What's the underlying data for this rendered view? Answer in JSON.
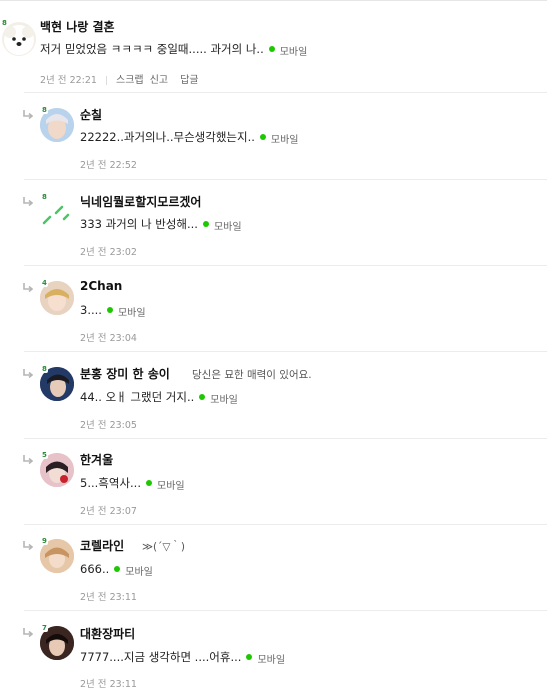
{
  "comments": [
    {
      "level": "8",
      "nickname": "백현 나랑 결혼",
      "text": "저거 믿었었음 ㅋㅋㅋㅋ 중일때..... 과거의 나..",
      "mobile": "모바일",
      "date": "2년 전",
      "time": "22:21",
      "actions": [
        "스크랩",
        "신고",
        "답글"
      ],
      "avatar_bg": "#f3efe6"
    },
    {
      "level": "8",
      "nickname": "순칠",
      "text": "22222..과거의나..무슨생각했는지..",
      "mobile": "모바일",
      "date": "2년 전",
      "time": "22:52",
      "avatar_bg": "#b9d3ec"
    },
    {
      "level": "8",
      "nickname": "닉네임뭘로할지모르겠어",
      "text": "333 과거의 나 반성해...",
      "mobile": "모바일",
      "date": "2년 전",
      "time": "23:02",
      "avatar_bg": "#ffffff"
    },
    {
      "level": "4",
      "nickname": "2Chan",
      "text": "3....",
      "mobile": "모바일",
      "date": "2년 전",
      "time": "23:04",
      "avatar_bg": "#e8d2c0"
    },
    {
      "level": "8",
      "nickname": "분홍 장미 한 송이",
      "extra": "당신은 묘한 매력이 있어요.",
      "text": "44.. 오ㅐ 그랬던 거지..",
      "mobile": "모바일",
      "date": "2년 전",
      "time": "23:05",
      "avatar_bg": "#243a66"
    },
    {
      "level": "5",
      "nickname": "한겨울",
      "text": "5...흑역사...",
      "mobile": "모바일",
      "date": "2년 전",
      "time": "23:07",
      "avatar_bg": "#e7c2c8"
    },
    {
      "level": "9",
      "nickname": "코렐라인",
      "extra": "≫(´▽｀)",
      "text": "666..",
      "mobile": "모바일",
      "date": "2년 전",
      "time": "23:11",
      "avatar_bg": "#dcb59a"
    },
    {
      "level": "7",
      "nickname": "대환장파티",
      "text": "7777....지금 생각하면 ....어휴...",
      "mobile": "모바일",
      "date": "2년 전",
      "time": "23:11",
      "avatar_bg": "#3a2520"
    }
  ],
  "colors": {
    "mobile_dot": "#1ec800",
    "level_badge": "#2b8c3a",
    "divider": "#ececec",
    "meta_text": "#999999"
  }
}
